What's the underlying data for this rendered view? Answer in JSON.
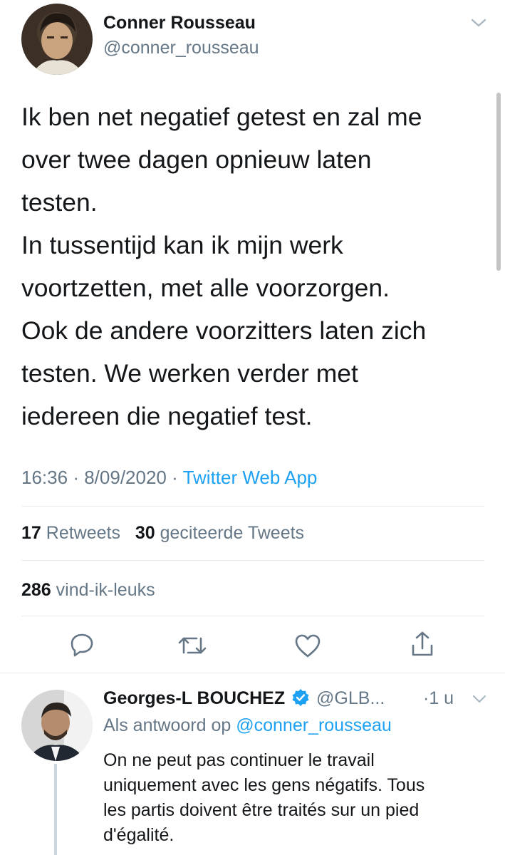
{
  "tweet": {
    "author": {
      "name": "Conner Rousseau",
      "handle": "@conner_rousseau"
    },
    "text_lines": [
      "Ik ben net negatief getest en zal me",
      "over twee dagen opnieuw laten",
      "testen.",
      "In tussentijd kan ik mijn werk",
      "voortzetten, met alle voorzorgen.",
      "Ook de andere voorzitters laten zich",
      "testen. We werken verder met",
      "iedereen die negatief test."
    ],
    "time": "16:36",
    "separator": "·",
    "date": "8/09/2020",
    "source": "Twitter Web App",
    "retweets": {
      "count": "17",
      "label": "Retweets"
    },
    "quotes": {
      "count": "30",
      "label": "geciteerde Tweets"
    },
    "likes": {
      "count": "286",
      "label": "vind-ik-leuks"
    }
  },
  "icons": {
    "chevron": "chevron-down-icon",
    "reply": "reply-icon",
    "retweet": "retweet-icon",
    "like": "heart-icon",
    "share": "share-icon",
    "verified": "verified-badge-icon"
  },
  "reply": {
    "author": {
      "name": "Georges-L BOUCHEZ",
      "handle": "@GLB...",
      "time": "·1 u"
    },
    "in_reply_prefix": "Als antwoord op",
    "in_reply_handle": "@conner_rousseau",
    "text_lines": [
      "On ne peut pas continuer le travail",
      "uniquement avec les gens négatifs. Tous",
      "les partis doivent être traités sur un pied",
      "d'égalité."
    ]
  },
  "colors": {
    "accent": "#1da1f2",
    "muted": "#657786",
    "text": "#14171a",
    "divider": "#e6ecf0"
  }
}
